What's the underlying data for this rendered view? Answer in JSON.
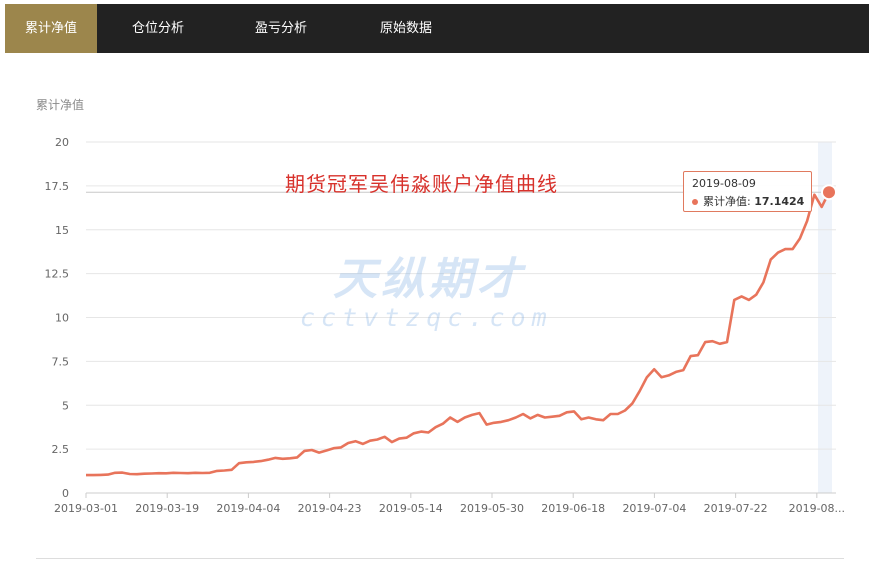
{
  "nav": {
    "tabs": [
      {
        "label": "累计净值",
        "active": true
      },
      {
        "label": "仓位分析",
        "active": false
      },
      {
        "label": "盈亏分析",
        "active": false
      },
      {
        "label": "原始数据",
        "active": false
      }
    ]
  },
  "panel": {
    "title": "累计净值"
  },
  "overlay_text": "期货冠军吴伟淼账户净值曲线",
  "watermark": {
    "cn": "天纵期才",
    "url": "cctvtzqc.com"
  },
  "tooltip": {
    "date": "2019-08-09",
    "label": "累计净值:",
    "value": "17.1424"
  },
  "colors": {
    "line": "#e8745b",
    "active_tab": "#9c864c",
    "navbar": "#222222",
    "overlay": "#d8312b"
  },
  "chart_data": {
    "type": "line",
    "ylim": [
      0,
      20
    ],
    "yticks": [
      "0",
      "2.5",
      "5",
      "7.5",
      "10",
      "12.5",
      "15",
      "17.5",
      "20"
    ],
    "xtick_labels": [
      "2019-03-01",
      "2019-03-19",
      "2019-04-04",
      "2019-04-23",
      "2019-05-14",
      "2019-05-30",
      "2019-06-18",
      "2019-07-04",
      "2019-07-22",
      "2019-08..."
    ],
    "grid": true,
    "series": [
      {
        "name": "累计净值",
        "values": [
          1.02,
          1.02,
          1.03,
          1.05,
          1.15,
          1.16,
          1.08,
          1.07,
          1.1,
          1.11,
          1.13,
          1.12,
          1.15,
          1.14,
          1.13,
          1.15,
          1.14,
          1.15,
          1.26,
          1.28,
          1.32,
          1.7,
          1.75,
          1.77,
          1.82,
          1.9,
          2.0,
          1.95,
          1.98,
          2.03,
          2.4,
          2.45,
          2.3,
          2.42,
          2.55,
          2.6,
          2.85,
          2.95,
          2.8,
          2.98,
          3.05,
          3.2,
          2.9,
          3.1,
          3.15,
          3.4,
          3.5,
          3.45,
          3.75,
          3.95,
          4.3,
          4.05,
          4.3,
          4.45,
          4.55,
          3.9,
          4.0,
          4.05,
          4.15,
          4.3,
          4.5,
          4.25,
          4.45,
          4.3,
          4.35,
          4.4,
          4.6,
          4.65,
          4.2,
          4.3,
          4.2,
          4.15,
          4.5,
          4.5,
          4.7,
          5.1,
          5.8,
          6.6,
          7.05,
          6.6,
          6.7,
          6.9,
          7.0,
          7.8,
          7.85,
          8.6,
          8.65,
          8.5,
          8.6,
          11.0,
          11.2,
          11.0,
          11.3,
          12.0,
          13.3,
          13.7,
          13.9,
          13.9,
          14.5,
          15.5,
          17.0,
          16.3,
          17.14
        ]
      }
    ]
  }
}
